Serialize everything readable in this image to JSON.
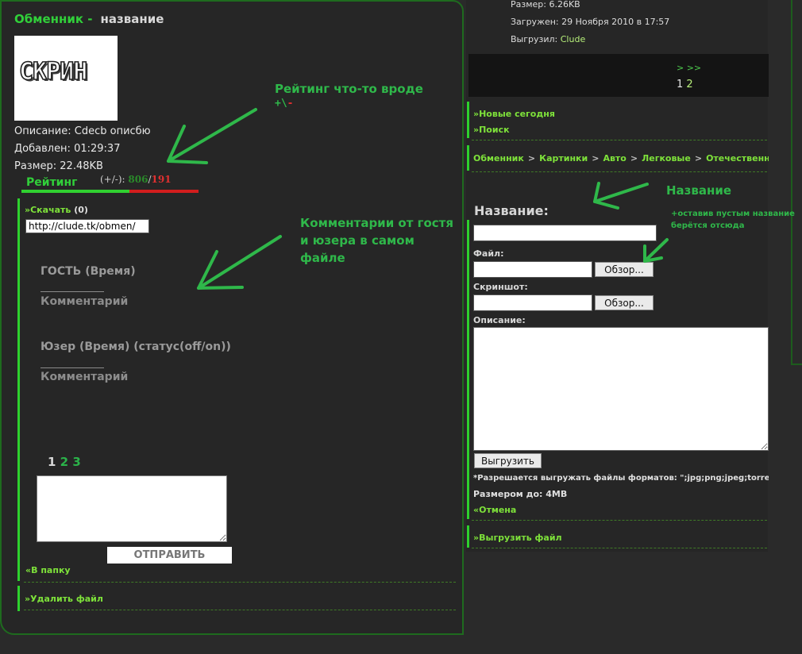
{
  "left": {
    "app_title": "Обменник -",
    "item_name": "название",
    "screenshot_text": "СКРИН",
    "description": "Описание: Cdecb описбю",
    "added": "Добавлен: 01:29:37",
    "size": "Размер: 22.48KB",
    "rating_label": "Рейтинг",
    "rating_prefix": "(+/-):",
    "rating_positive": "806",
    "rating_separator": "/",
    "rating_negative": "191",
    "download_label": "»Скачать",
    "download_count": "(0)",
    "download_url": "http://clude.tk/obmen/",
    "comments": [
      {
        "header": "ГОСТЬ (Время)",
        "body": "Комментарий"
      },
      {
        "header": "Юзер (Время) (статус(off/on))",
        "body": "Комментарий"
      }
    ],
    "pages": [
      "1",
      "2",
      "3"
    ],
    "send_label": "ОТПРАВИТЬ",
    "to_folder": "«В папку",
    "delete_file": "»Удалить файл"
  },
  "right": {
    "file_size": "Размер: 6.26KB",
    "uploaded": "Загружен: 29 Ноября 2010 в 17:57",
    "uploader_label": "Выгрузил:",
    "uploader_name": "Clude",
    "pager_arrows": "> >>",
    "pages": [
      "1",
      "2"
    ],
    "new_today": "»Новые сегодня",
    "search": "»Поиск",
    "breadcrumb": [
      "Обменник",
      "Картинки",
      "Авто",
      "Легковые",
      "Отечественное авто"
    ],
    "breadcrumb_sep": ">",
    "upload_heading": "Название:",
    "file_label": "Файл:",
    "screenshot_label": "Скриншот:",
    "browse_label": "Обзор...",
    "description_label": "Описание:",
    "upload_button": "Выгрузить",
    "formats_note": "*Разрешается выгружать файлы форматов: \";jpg;png;jpeg;torrent;",
    "size_limit": "Размером до: 4MB",
    "cancel": "«Отмена",
    "upload_file": "»Выгрузить файл"
  },
  "annotations": {
    "rating_note": "Рейтинг что-то вроде",
    "rating_plus": "+\\",
    "rating_minus": "-",
    "comments_note": "Комментарии от гостя и юзера в самом файле",
    "name_note": "Название",
    "blank_note": "+оставив пустым название берётся отсюда"
  },
  "colors": {
    "accent_green": "#31d03a",
    "link_green": "#7ee23a",
    "negative_red": "#e03030",
    "annotation_green": "#2fb84a"
  }
}
